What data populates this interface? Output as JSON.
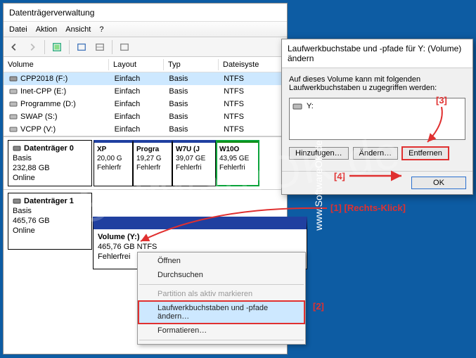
{
  "window": {
    "title": "Datenträgerverwaltung"
  },
  "menu": {
    "file": "Datei",
    "action": "Aktion",
    "view": "Ansicht",
    "help": "?"
  },
  "table": {
    "headers": {
      "volume": "Volume",
      "layout": "Layout",
      "type": "Typ",
      "fs": "Dateisyste"
    },
    "rows": [
      {
        "name": "CPP2018 (F:)",
        "layout": "Einfach",
        "type": "Basis",
        "fs": "NTFS",
        "selected": true
      },
      {
        "name": "Inet-CPP (E:)",
        "layout": "Einfach",
        "type": "Basis",
        "fs": "NTFS",
        "selected": false
      },
      {
        "name": "Programme (D:)",
        "layout": "Einfach",
        "type": "Basis",
        "fs": "NTFS",
        "selected": false
      },
      {
        "name": "SWAP (S:)",
        "layout": "Einfach",
        "type": "Basis",
        "fs": "NTFS",
        "selected": false
      },
      {
        "name": "VCPP (V:)",
        "layout": "Einfach",
        "type": "Basis",
        "fs": "NTFS",
        "selected": false
      }
    ]
  },
  "disks": [
    {
      "title": "Datenträger 0",
      "kind": "Basis",
      "size": "232,88 GB",
      "status": "Online",
      "parts": [
        {
          "name": "XP",
          "size": "20,00 G",
          "health": "Fehlerfr"
        },
        {
          "name": "Progra",
          "size": "19,27 G",
          "health": "Fehlerfr"
        },
        {
          "name": "W7U (J",
          "size": "39,07 GE",
          "health": "Fehlerfri"
        },
        {
          "name": "W10O",
          "size": "43,95 GE",
          "health": "Fehlerfri"
        }
      ]
    },
    {
      "title": "Datenträger 1",
      "kind": "Basis",
      "size": "465,76 GB",
      "status": "Online",
      "parts": []
    }
  ],
  "volume_banner": {
    "name": "Volume (Y:)",
    "size": "465,76 GB NTFS",
    "health": "Fehlerfrei"
  },
  "context_menu": {
    "open": "Öffnen",
    "browse": "Durchsuchen",
    "mark_active": "Partition als aktiv markieren",
    "change_letter": "Laufwerkbuchstaben und -pfade ändern…",
    "format": "Formatieren…"
  },
  "dialog": {
    "title": "Laufwerkbuchstabe und -pfade für Y: (Volume) ändern",
    "desc": "Auf dieses Volume kann mit folgenden Laufwerkbuchstaben u zugegriffen werden:",
    "drive": "Y:",
    "btn_add": "Hinzufügen…",
    "btn_change": "Ändern…",
    "btn_remove": "Entfernen",
    "btn_ok": "OK"
  },
  "annotations": {
    "a1": "[1]  [Rechts-Klick]",
    "a2": "[2]",
    "a3": "[3]",
    "a4": "[4]"
  },
  "watermark": {
    "main": "SoftwareOK.de",
    "side": "www.SoftwareOK.de :-)"
  }
}
